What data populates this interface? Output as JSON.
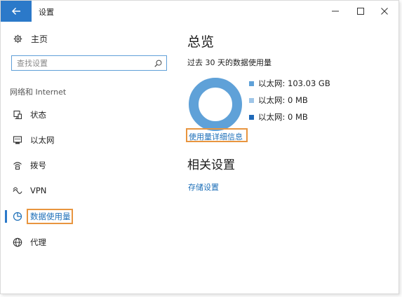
{
  "window": {
    "title": "设置",
    "back_icon": "arrow-left-icon",
    "accent": "#2b79c9"
  },
  "sidebar": {
    "home_label": "主页",
    "search_placeholder": "查找设置",
    "section_label": "网络和 Internet",
    "items": [
      {
        "label": "状态",
        "icon": "status-icon"
      },
      {
        "label": "以太网",
        "icon": "ethernet-icon"
      },
      {
        "label": "拨号",
        "icon": "dialup-icon"
      },
      {
        "label": "VPN",
        "icon": "vpn-icon"
      },
      {
        "label": "数据使用量",
        "icon": "data-usage-icon",
        "active": true
      },
      {
        "label": "代理",
        "icon": "proxy-icon"
      }
    ]
  },
  "main": {
    "title": "总览",
    "subtitle": "过去 30 天的数据使用量",
    "legend": [
      {
        "label": "以太网: 103.03 GB",
        "color": "#5fa1d8"
      },
      {
        "label": "以太网: 0 MB",
        "color": "#9fc6e8"
      },
      {
        "label": "以太网: 0 MB",
        "color": "#1f69b8"
      }
    ],
    "details_link": "使用量详细信息",
    "related_title": "相关设置",
    "storage_link": "存储设置"
  },
  "chart_data": {
    "type": "pie",
    "categories": [
      "以太网",
      "以太网",
      "以太网"
    ],
    "values": [
      103.03,
      0,
      0
    ],
    "unit": "GB"
  }
}
